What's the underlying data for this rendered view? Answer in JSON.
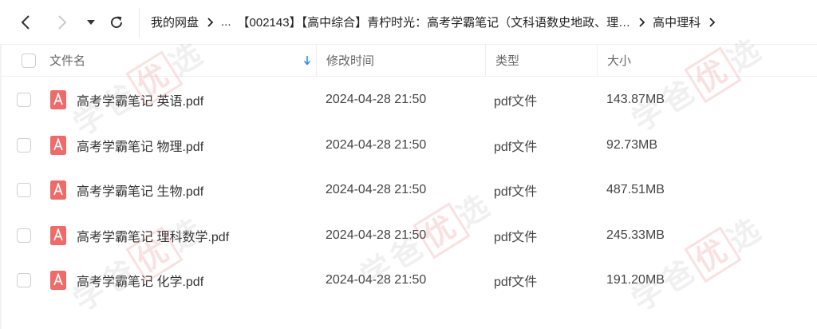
{
  "toolbar": {
    "breadcrumb": [
      "我的网盘",
      "...",
      "【002143】【高中综合】青柠时光：高考学霸笔记（文科语数史地政、理…",
      "高中理科"
    ]
  },
  "header": {
    "name": "文件名",
    "time": "修改时间",
    "type": "类型",
    "size": "大小"
  },
  "files": [
    {
      "name": "高考学霸笔记 英语.pdf",
      "time": "2024-04-28 21:50",
      "type": "pdf文件",
      "size": "143.87MB"
    },
    {
      "name": "高考学霸笔记 物理.pdf",
      "time": "2024-04-28 21:50",
      "type": "pdf文件",
      "size": "92.73MB"
    },
    {
      "name": "高考学霸笔记 生物.pdf",
      "time": "2024-04-28 21:50",
      "type": "pdf文件",
      "size": "487.51MB"
    },
    {
      "name": "高考学霸笔记 理科数学.pdf",
      "time": "2024-04-28 21:50",
      "type": "pdf文件",
      "size": "245.33MB"
    },
    {
      "name": "高考学霸笔记 化学.pdf",
      "time": "2024-04-28 21:50",
      "type": "pdf文件",
      "size": "191.20MB"
    }
  ],
  "watermark": {
    "pre": "学",
    "mid": "爸",
    "hl": "优",
    "post": "选"
  },
  "colors": {
    "pdf_icon": "#f06a6a",
    "sort_arrow": "#2f8df0"
  }
}
